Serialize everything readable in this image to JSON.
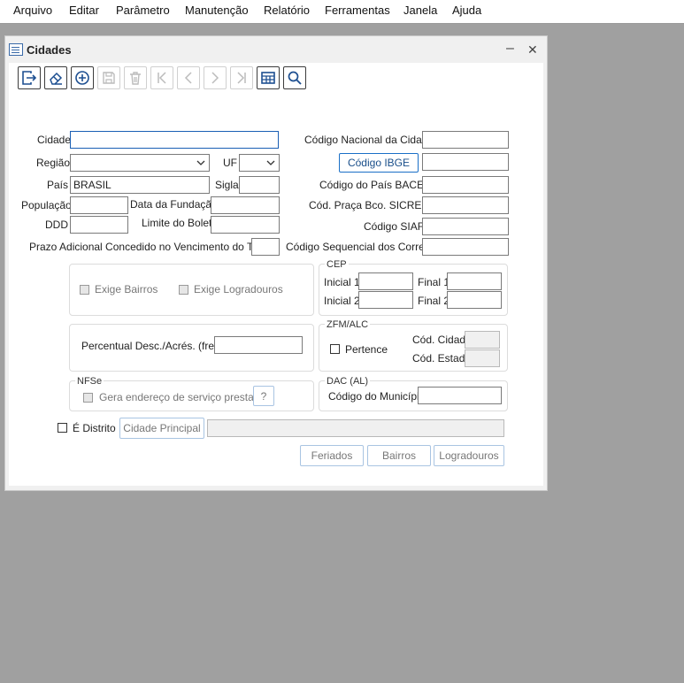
{
  "menu": [
    "Arquivo",
    "Editar",
    "Parâmetro",
    "Manutenção",
    "Relatório",
    "Ferramentas",
    "Janela",
    "Ajuda"
  ],
  "window": {
    "title": "Cidades",
    "minimize_glyph": "–",
    "close_glyph": "✕"
  },
  "toolbar": {
    "buttons": [
      "exit-icon",
      "eraser-icon",
      "add-icon",
      "save-icon",
      "delete-icon",
      "first-record-icon",
      "previous-record-icon",
      "next-record-icon",
      "last-record-icon",
      "grid-view-icon",
      "search-icon"
    ]
  },
  "form": {
    "cidade": {
      "label": "Cidade",
      "value": ""
    },
    "regiao": {
      "label": "Região",
      "value": ""
    },
    "uf": {
      "label": "UF",
      "value": ""
    },
    "pais": {
      "label": "País",
      "value": "BRASIL"
    },
    "sigla": {
      "label": "Sigla",
      "value": ""
    },
    "populacao": {
      "label": "População",
      "value": ""
    },
    "data_fundacao": {
      "label": "Data da Fundação",
      "value": ""
    },
    "ddd": {
      "label": "DDD",
      "value": ""
    },
    "limite_boleto": {
      "label": "Limite do Boleto",
      "value": ""
    },
    "prazo_adicional": {
      "label": "Prazo Adicional Concedido no Vencimento do Título",
      "value": ""
    },
    "codigo_nacional": {
      "label": "Código Nacional da Cidade",
      "value": ""
    },
    "codigo_ibge": {
      "button_label": "Código IBGE",
      "value": ""
    },
    "codigo_pais_bacen": {
      "label": "Código do País BACEN",
      "value": ""
    },
    "cod_praca_sicredi": {
      "label": "Cód. Praça Bco. SICREDI",
      "value": ""
    },
    "codigo_siafi": {
      "label": "Código SIAFI",
      "value": ""
    },
    "codigo_correios": {
      "label": "Código Sequencial dos Correios",
      "value": ""
    }
  },
  "exige": {
    "bairros": "Exige Bairros",
    "logradouros": "Exige Logradouros"
  },
  "cep": {
    "title": "CEP",
    "inicial1": "Inicial 1",
    "final1": "Final 1",
    "inicial2": "Inicial 2",
    "final2": "Final 2"
  },
  "percentual": {
    "label": "Percentual Desc./Acrés. (frete)",
    "value": ""
  },
  "zfm": {
    "title": "ZFM/ALC",
    "pertence": "Pertence",
    "cod_cidade": "Cód. Cidade",
    "cod_estado": "Cód. Estado"
  },
  "nfse": {
    "title": "NFSe",
    "gera_endereco": "Gera endereço de serviço prestado",
    "help": "?"
  },
  "dac": {
    "title": "DAC (AL)",
    "codigo_municipio": "Código do Município",
    "value": ""
  },
  "distrito": {
    "label": "É Distrito",
    "cidade_principal_button": "Cidade Principal",
    "value": ""
  },
  "bottom_buttons": {
    "feriados": "Feriados",
    "bairros": "Bairros",
    "logradouros": "Logradouros"
  }
}
